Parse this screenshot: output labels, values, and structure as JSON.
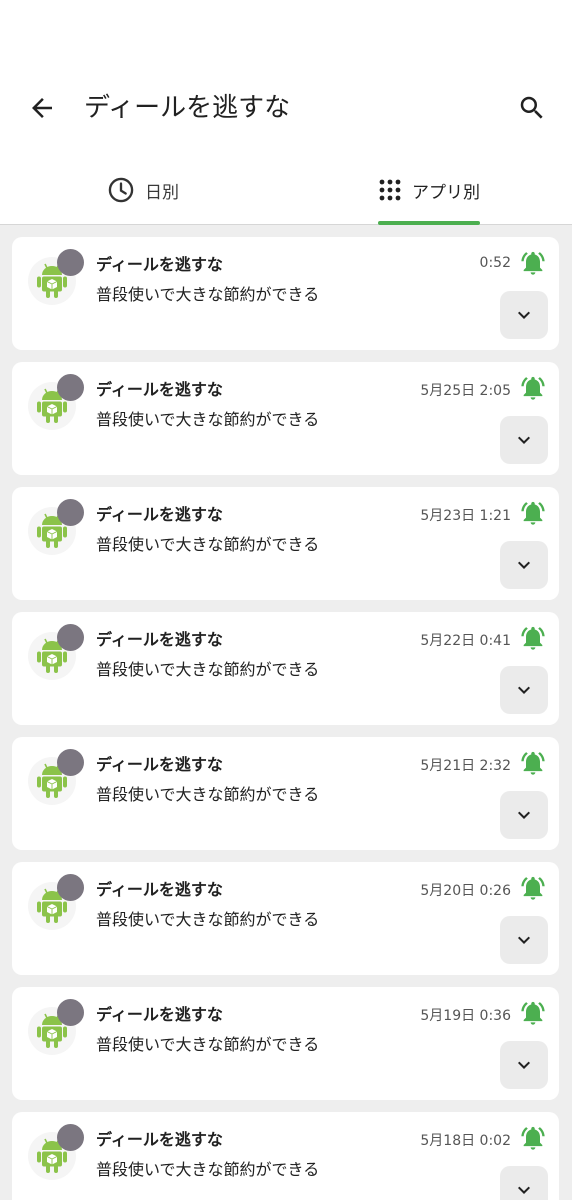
{
  "header": {
    "title": "ディールを逃すな",
    "back_icon": "arrow-back-icon",
    "search_icon": "search-icon"
  },
  "tabs": [
    {
      "label": "日別",
      "icon": "clock-icon",
      "active": false
    },
    {
      "label": "アプリ別",
      "icon": "apps-grid-icon",
      "active": true
    }
  ],
  "colors": {
    "accent": "#4caf50",
    "list_background": "#eeeeee",
    "badge": "#7b7680"
  },
  "notifications": [
    {
      "title": "ディールを逃すな",
      "text": "普段使いで大きな節約ができる",
      "time": "0:52"
    },
    {
      "title": "ディールを逃すな",
      "text": "普段使いで大きな節約ができる",
      "time": "5月25日 2:05"
    },
    {
      "title": "ディールを逃すな",
      "text": "普段使いで大きな節約ができる",
      "time": "5月23日 1:21"
    },
    {
      "title": "ディールを逃すな",
      "text": "普段使いで大きな節約ができる",
      "time": "5月22日 0:41"
    },
    {
      "title": "ディールを逃すな",
      "text": "普段使いで大きな節約ができる",
      "time": "5月21日 2:32"
    },
    {
      "title": "ディールを逃すな",
      "text": "普段使いで大きな節約ができる",
      "time": "5月20日 0:26"
    },
    {
      "title": "ディールを逃すな",
      "text": "普段使いで大きな節約ができる",
      "time": "5月19日 0:36"
    },
    {
      "title": "ディールを逃すな",
      "text": "普段使いで大きな節約ができる",
      "time": "5月18日 0:02"
    }
  ]
}
